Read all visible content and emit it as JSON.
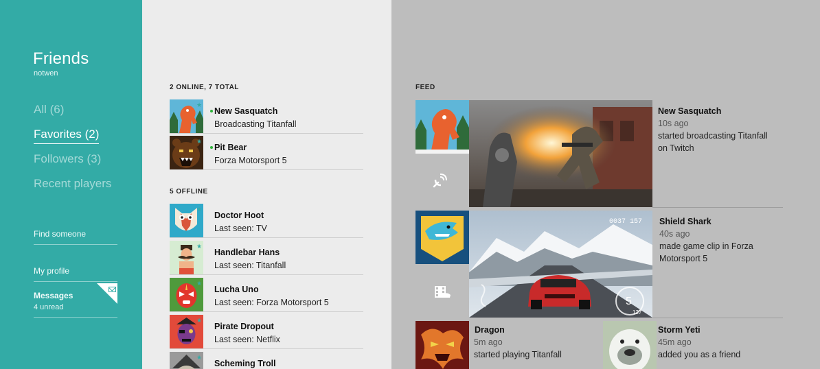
{
  "sidebar": {
    "title": "Friends",
    "username": "notwen",
    "filters": [
      {
        "label": "All (6)",
        "active": false
      },
      {
        "label": "Favorites (2)",
        "active": true
      },
      {
        "label": "Followers (3)",
        "active": false
      },
      {
        "label": "Recent players",
        "active": false
      }
    ],
    "find_someone": "Find someone",
    "my_profile": "My profile",
    "messages": {
      "label": "Messages",
      "sub": "4 unread",
      "icon": "mail-icon"
    }
  },
  "friends": {
    "online_header": "2 ONLINE, 7 TOTAL",
    "offline_header": "5 OFFLINE",
    "online": [
      {
        "name": "New Sasquatch",
        "status": "Broadcasting Titanfall",
        "favorite": true
      },
      {
        "name": "Pit Bear",
        "status": "Forza Motorsport 5",
        "favorite": true
      }
    ],
    "offline": [
      {
        "name": "Doctor Hoot",
        "status": "Last seen: TV",
        "favorite": true
      },
      {
        "name": "Handlebar Hans",
        "status": "Last seen: Titanfall",
        "favorite": true
      },
      {
        "name": "Lucha Uno",
        "status": "Last seen: Forza Motorsport 5",
        "favorite": true
      },
      {
        "name": "Pirate Dropout",
        "status": "Last seen: Netflix",
        "favorite": true
      },
      {
        "name": "Scheming Troll",
        "status": "",
        "favorite": true
      }
    ]
  },
  "feed": {
    "header": "FEED",
    "items": [
      {
        "name": "New Sasquatch",
        "time": "10s ago",
        "text": "started broadcasting Titanfall on Twitch",
        "type_icon": "broadcast-icon"
      },
      {
        "name": "Shield Shark",
        "time": "40s ago",
        "text": "made game clip in Forza Motorsport 5",
        "type_icon": "game-clip-icon"
      },
      {
        "name": "Dragon",
        "time": "5m ago",
        "text": "started playing Titanfall"
      },
      {
        "name": "Storm Yeti",
        "time": "45m ago",
        "text": "added you as a friend"
      }
    ],
    "hud": {
      "odometer": "0037 157",
      "gear": "5",
      "speed": "127"
    }
  },
  "colors": {
    "accent": "#33aba6",
    "online": "#2db33a",
    "feed_bg": "#bdbdbd",
    "list_bg": "#ececec"
  }
}
